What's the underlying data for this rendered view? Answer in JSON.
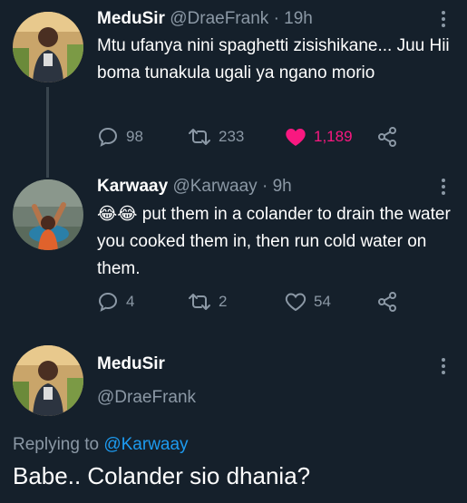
{
  "tweets": [
    {
      "name": "MeduSir",
      "handle": "@DraeFrank",
      "separator": "·",
      "time": "19h",
      "text": "Mtu ufanya nini spaghetti zisishikane... Juu Hii boma tunakula ugali ya ngano morio",
      "replies": "98",
      "retweets": "233",
      "likes": "1,189",
      "liked": true
    },
    {
      "name": "Karwaay",
      "handle": "@Karwaay",
      "separator": "·",
      "time": "9h",
      "emoji": "😂😂",
      "text": "put them in a colander to drain the water you cooked them in,  then run cold water on them.",
      "replies": "4",
      "retweets": "2",
      "likes": "54",
      "liked": false
    }
  ],
  "main_tweet": {
    "name": "MeduSir",
    "handle": "@DraeFrank",
    "replying_prefix": "Replying to",
    "replying_to": "@Karwaay",
    "text": "Babe.. Colander sio dhania?"
  },
  "icons": {
    "reply": "reply-icon",
    "retweet": "retweet-icon",
    "like": "heart-icon",
    "share": "share-icon",
    "more": "more-dots-icon"
  },
  "colors": {
    "background": "#15202b",
    "muted": "#8b98a5",
    "like": "#f91880",
    "link": "#1d9bf0",
    "thread_line": "#38444d"
  }
}
